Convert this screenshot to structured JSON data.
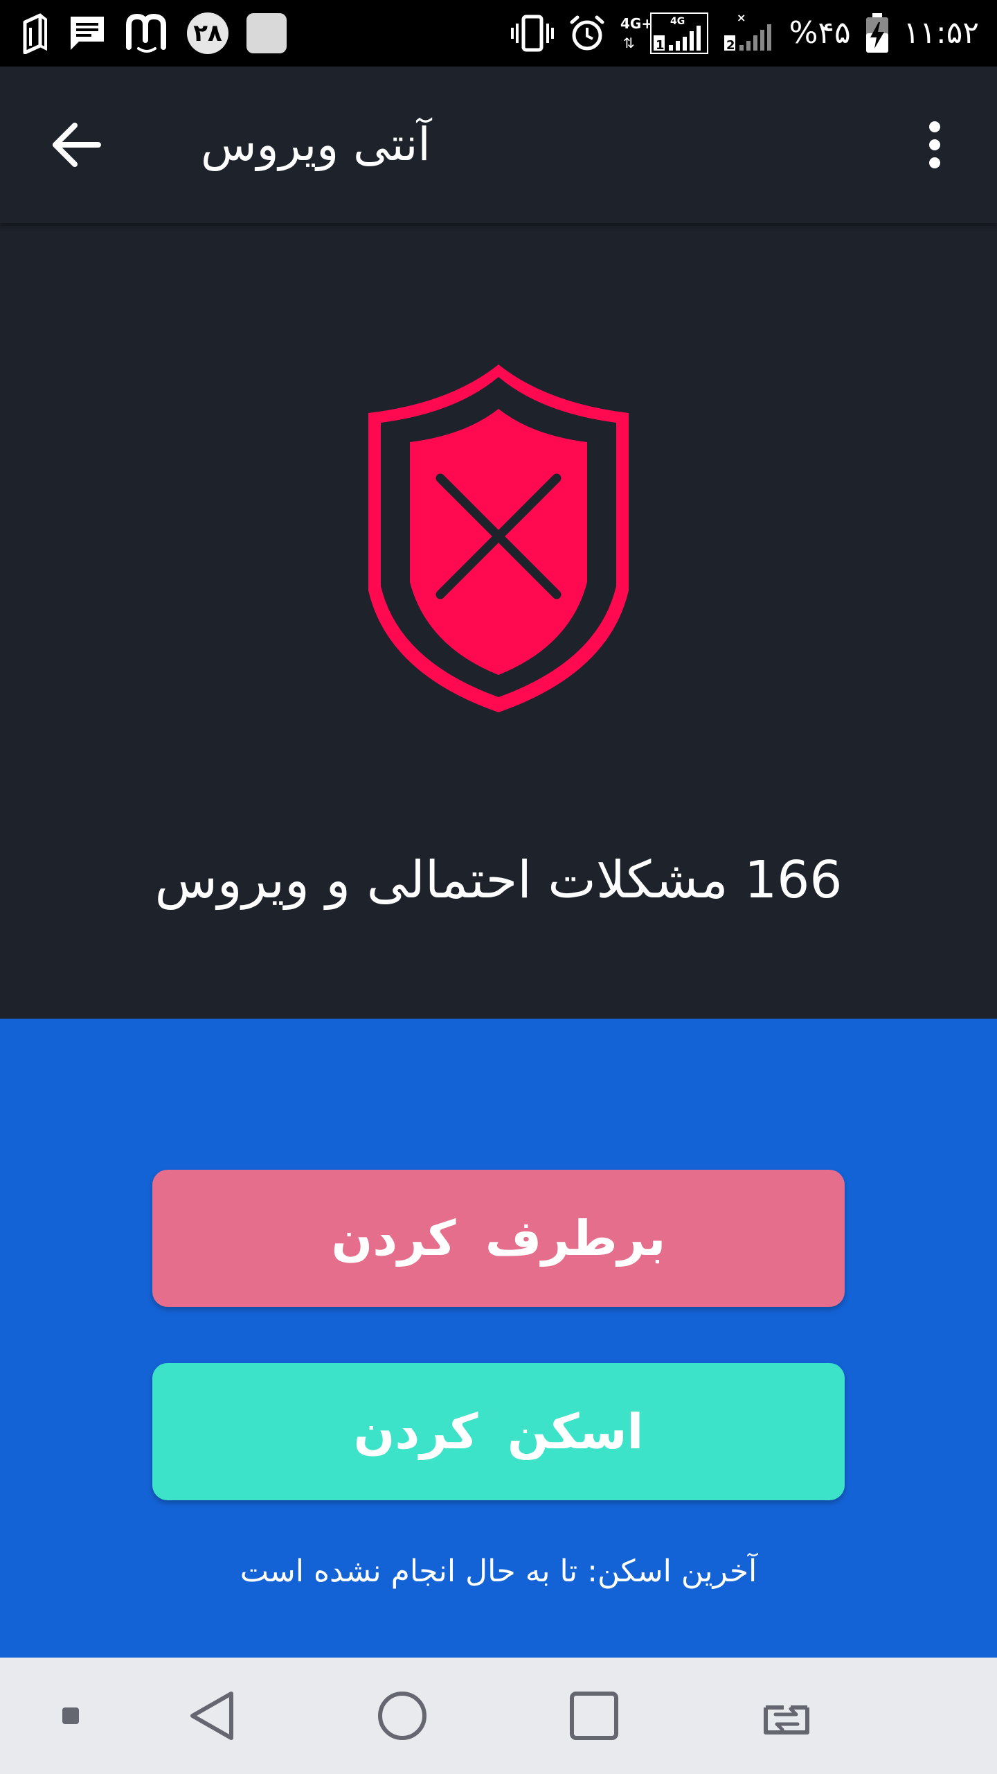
{
  "status_bar": {
    "notification_badge": "۲۸",
    "battery_percent": "%۴۵",
    "time": "۱۱:۵۲",
    "network_1": "4G+",
    "network_2": "4G",
    "sim_1": "1",
    "sim_2": "2"
  },
  "app_bar": {
    "title": "آنتی ویروس"
  },
  "hero": {
    "threat_count_text": "166 مشکلات احتمالی و ویروس"
  },
  "actions": {
    "fix_label": "برطرف کردن",
    "scan_label": "اسکن کردن",
    "last_scan_text": "آخرین اسکن: تا به حال انجام نشده است"
  },
  "icons": {
    "back": "arrow-left-icon",
    "menu": "more-vertical-icon",
    "shield": "shield-x-icon",
    "nav_small": "square-dot-icon",
    "nav_back": "triangle-back-icon",
    "nav_home": "circle-home-icon",
    "nav_recents": "square-recents-icon",
    "nav_switch": "switch-apps-icon"
  },
  "colors": {
    "background": "#1d222b",
    "shield_red": "#ff0a50",
    "action_blue": "#1463d6",
    "fix_pink": "#e46e8c",
    "scan_teal": "#3de3c9",
    "nav_bar": "#e9eaee"
  }
}
